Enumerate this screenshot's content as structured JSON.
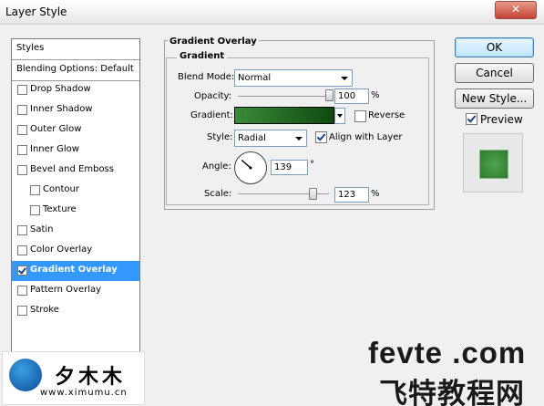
{
  "window": {
    "title": "Layer Style",
    "close_glyph": "✕"
  },
  "styles_list": {
    "header": "Styles",
    "blending": "Blending Options: Default",
    "items": [
      {
        "label": "Drop Shadow",
        "checked": false
      },
      {
        "label": "Inner Shadow",
        "checked": false
      },
      {
        "label": "Outer Glow",
        "checked": false
      },
      {
        "label": "Inner Glow",
        "checked": false
      },
      {
        "label": "Bevel and Emboss",
        "checked": false
      },
      {
        "label": "Contour",
        "checked": false
      },
      {
        "label": "Texture",
        "checked": false
      },
      {
        "label": "Satin",
        "checked": false
      },
      {
        "label": "Color Overlay",
        "checked": false
      },
      {
        "label": "Gradient Overlay",
        "checked": true
      },
      {
        "label": "Pattern Overlay",
        "checked": false
      },
      {
        "label": "Stroke",
        "checked": false
      }
    ]
  },
  "panel": {
    "title": "Gradient Overlay",
    "subtitle": "Gradient",
    "blend_mode_label": "Blend Mode:",
    "blend_mode_value": "Normal",
    "opacity_label": "Opacity:",
    "opacity_value": "100",
    "opacity_fraction": 1.0,
    "percent": "%",
    "gradient_label": "Gradient:",
    "gradient_colors": [
      "#3a8a3a",
      "#0f4a0f"
    ],
    "reverse_label": "Reverse",
    "style_label": "Style:",
    "style_value": "Radial",
    "align_label": "Align with Layer",
    "angle_label": "Angle:",
    "angle_value": "139",
    "degree": "°",
    "scale_label": "Scale:",
    "scale_value": "123",
    "scale_fraction": 0.82
  },
  "buttons": {
    "ok": "OK",
    "cancel": "Cancel",
    "new_style": "New Style...",
    "preview_label": "Preview"
  },
  "watermark": {
    "chinese": "夕木木",
    "url": "www.ximumu.cn",
    "site": "fevte .com",
    "site_cn": "飞特教程网"
  }
}
